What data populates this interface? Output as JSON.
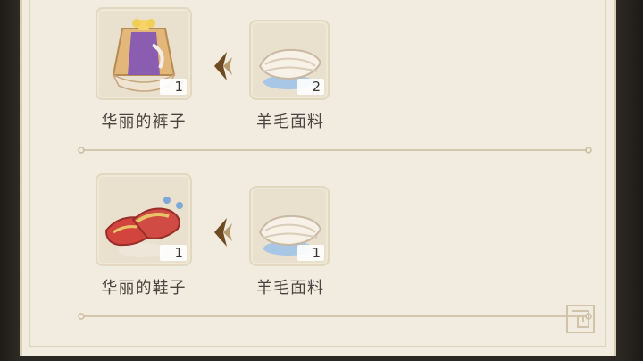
{
  "recipes": [
    {
      "result": {
        "name": "华丽的裤子",
        "count": "1",
        "icon": "fancy-pants-icon"
      },
      "material": {
        "name": "羊毛面料",
        "count": "2",
        "icon": "wool-fabric-icon"
      }
    },
    {
      "result": {
        "name": "华丽的鞋子",
        "count": "1",
        "icon": "fancy-shoes-icon"
      },
      "material": {
        "name": "羊毛面料",
        "count": "1",
        "icon": "wool-fabric-icon"
      }
    }
  ],
  "colors": {
    "panel_bg": "#f1ecdf",
    "slot_bg": "#e9e1cd",
    "text": "#4b4440",
    "arrow": "#6e4a22"
  }
}
